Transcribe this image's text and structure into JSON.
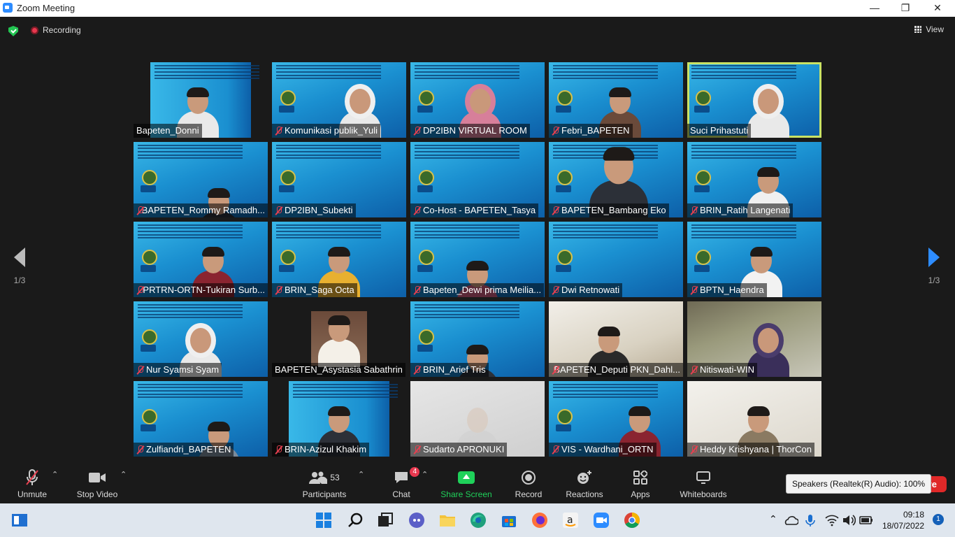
{
  "window": {
    "title": "Zoom Meeting",
    "minimize": "—",
    "maximize": "❐",
    "close": "✕"
  },
  "meeting": {
    "recording_label": "Recording",
    "view_label": "View",
    "page_left": "1/3",
    "page_right": "1/3"
  },
  "participants": [
    {
      "name": "Bapeten_Donni",
      "muted": false
    },
    {
      "name": "Komunikasi publik_Yuli",
      "muted": true
    },
    {
      "name": "DP2IBN VIRTUAL ROOM",
      "muted": true
    },
    {
      "name": "Febri_BAPETEN",
      "muted": true
    },
    {
      "name": "Suci Prihastuti",
      "muted": false
    },
    {
      "name": "BAPETEN_Rommy Ramadh...",
      "muted": true
    },
    {
      "name": "DP2IBN_Subekti",
      "muted": true
    },
    {
      "name": "Co-Host - BAPETEN_Tasya",
      "muted": true
    },
    {
      "name": "BAPETEN_Bambang Eko",
      "muted": true
    },
    {
      "name": "BRIN_Ratih Langenati",
      "muted": true
    },
    {
      "name": "PRTRN-ORTN-Tukiran Surb...",
      "muted": true
    },
    {
      "name": "BRIN_Saga Octa",
      "muted": true
    },
    {
      "name": "Bapeten_Dewi prima Meilia...",
      "muted": true
    },
    {
      "name": "Dwi Retnowati",
      "muted": true
    },
    {
      "name": "BPTN_Haendra",
      "muted": true
    },
    {
      "name": "Nur Syamsi Syam",
      "muted": true
    },
    {
      "name": "BAPETEN_Asystasia Sabathrin",
      "muted": false
    },
    {
      "name": "BRIN_Arief Tris",
      "muted": true
    },
    {
      "name": "BAPETEN_Deputi PKN_Dahl...",
      "muted": true
    },
    {
      "name": "Nitiswati-WIN",
      "muted": true
    },
    {
      "name": "Zulfiandri_BAPETEN",
      "muted": true
    },
    {
      "name": "BRIN-Azizul Khakim",
      "muted": true
    },
    {
      "name": "Sudarto APRONUKI",
      "muted": true
    },
    {
      "name": "VIS - Wardhani_ORTN",
      "muted": true
    },
    {
      "name": "Heddy Krishyana | ThorCon",
      "muted": true
    }
  ],
  "controls": {
    "unmute": "Unmute",
    "stop_video": "Stop Video",
    "participants": "Participants",
    "participants_count": "53",
    "chat": "Chat",
    "chat_badge": "4",
    "share_screen": "Share Screen",
    "record": "Record",
    "reactions": "Reactions",
    "apps": "Apps",
    "whiteboards": "Whiteboards",
    "leave": "ve",
    "tooltip": "Speakers (Realtek(R) Audio): 100%"
  },
  "taskbar": {
    "time": "09:18",
    "date": "18/07/2022",
    "notifications": "1"
  }
}
